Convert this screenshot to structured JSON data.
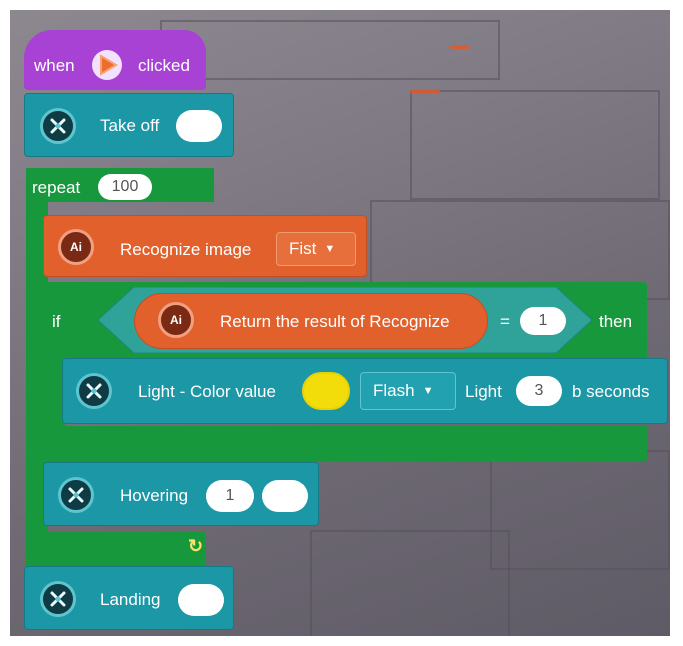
{
  "event": {
    "when": "when",
    "clicked": "clicked"
  },
  "takeoff": {
    "label": "Take off",
    "value": ""
  },
  "repeat": {
    "label": "repeat",
    "count": "100"
  },
  "recognize": {
    "label": "Recognize image",
    "option": "Fist",
    "icon_text": "Ai"
  },
  "if_block": {
    "if": "if",
    "then": "then",
    "result_label": "Return the result of Recognize",
    "op": "=",
    "value": "1",
    "icon_text": "Ai"
  },
  "light": {
    "label": "Light - Color value",
    "color": "#f2dd0a",
    "mode": "Flash",
    "light_label": "Light",
    "seconds": "3",
    "suffix": "b seconds"
  },
  "hover": {
    "label": "Hovering",
    "value1": "1",
    "value2": ""
  },
  "landing": {
    "label": "Landing",
    "value": ""
  },
  "loop_arrow": "↻",
  "colors": {
    "event": "#a742d5",
    "drone": "#1b97a6",
    "control": "#18983d",
    "ai": "#e2602b"
  }
}
